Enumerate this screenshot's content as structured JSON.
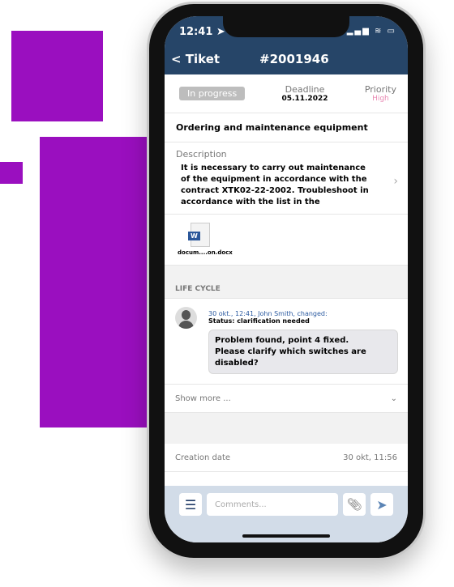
{
  "status_bar": {
    "time": "12:41 ➤",
    "icons": "▂▄▆ ≋ ▭"
  },
  "header": {
    "back_label": "< Tiket",
    "ticket_number": "#2001946"
  },
  "summary": {
    "status": "In progress",
    "deadline_label": "Deadline",
    "deadline": "05.11.2022",
    "priority_label": "Priority",
    "priority": "High",
    "priority_color": "#e98ab4"
  },
  "title": "Ordering and maintenance equipment",
  "description": {
    "label": "Description",
    "text": "It is necessary to carry out maintenance of the equipment in accordance with the contract XTK02-22-2002. Troubleshoot in accordance with the list in the"
  },
  "attachment": {
    "name": "docum....on.docx",
    "icon": "word-file-icon",
    "badge": "W"
  },
  "life_cycle": {
    "label": "LIFE CYCLE",
    "entry": {
      "meta": "30 okt., 12:41, John Smith, changed:",
      "status": "Status: clarification needed",
      "message_line1": "Problem found, point 4 fixed.",
      "message_line2": "Please clarify which switches are disabled?"
    },
    "show_more": "Show more ..."
  },
  "details": {
    "creation_label": "Creation date",
    "creation_value": "30 okt, 11:56"
  },
  "composer": {
    "placeholder": "Comments..."
  },
  "colors": {
    "header": "#264568",
    "accent_purple": "#9a0fbf"
  }
}
